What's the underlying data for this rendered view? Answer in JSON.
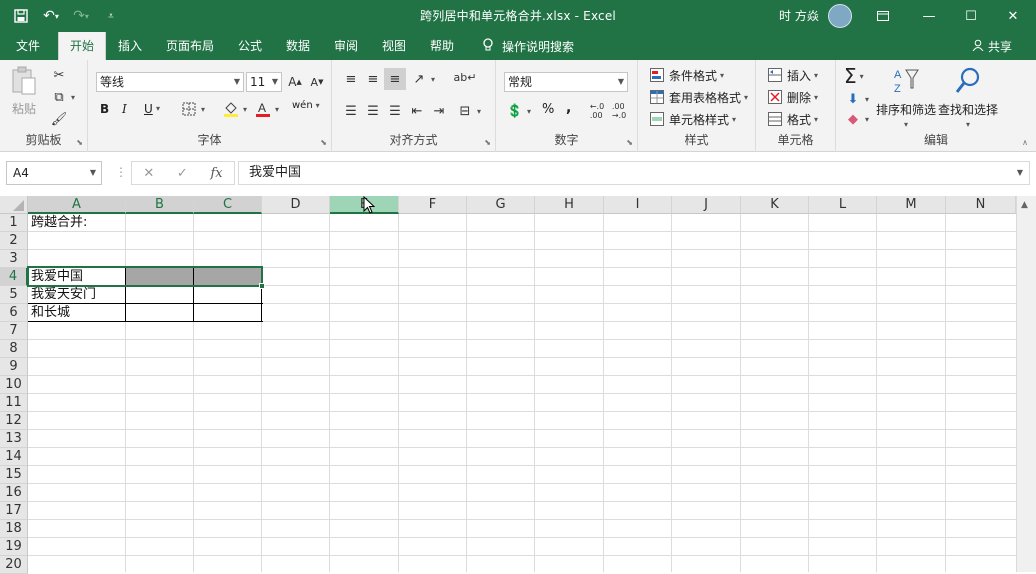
{
  "titlebar": {
    "title": "跨列居中和单元格合并.xlsx  -  Excel",
    "user": "时 方焱",
    "icons": [
      "save-icon",
      "undo-icon",
      "redo-icon",
      "customize-qat-icon"
    ],
    "window_controls": [
      "ribbon-display-options-icon",
      "minimize-icon",
      "maximize-icon",
      "close-icon"
    ]
  },
  "tabs": {
    "items": [
      {
        "label": "文件"
      },
      {
        "label": "开始"
      },
      {
        "label": "插入"
      },
      {
        "label": "页面布局"
      },
      {
        "label": "公式"
      },
      {
        "label": "数据"
      },
      {
        "label": "审阅"
      },
      {
        "label": "视图"
      },
      {
        "label": "帮助"
      }
    ],
    "active": "开始",
    "tell_me": "操作说明搜索",
    "share": "共享"
  },
  "ribbon": {
    "clipboard": {
      "label": "剪贴板",
      "paste": "粘贴"
    },
    "font": {
      "label": "字体",
      "font_name": "等线",
      "font_size": "11",
      "bold": "B",
      "italic": "I",
      "underline": "U",
      "wen": "wén"
    },
    "alignment": {
      "label": "对齐方式"
    },
    "number": {
      "label": "数字",
      "format": "常规",
      "percent": "%",
      "comma": ","
    },
    "styles": {
      "label": "样式",
      "conditional": "条件格式",
      "table": "套用表格格式",
      "cell_styles": "单元格样式"
    },
    "cells": {
      "label": "单元格",
      "insert": "插入",
      "delete": "删除",
      "format": "格式"
    },
    "editing": {
      "label": "编辑",
      "sort": "排序和筛选",
      "find": "查找和选择"
    }
  },
  "formula_bar": {
    "name_box": "A4",
    "fx": "fx",
    "content": "我爱中国"
  },
  "sheet": {
    "columns": [
      "A",
      "B",
      "C",
      "D",
      "E",
      "F",
      "G",
      "H",
      "I",
      "J",
      "K",
      "L",
      "M",
      "N"
    ],
    "rows": [
      "1",
      "2",
      "3",
      "4",
      "5",
      "6",
      "7",
      "8",
      "9",
      "10",
      "11",
      "12",
      "13",
      "14",
      "15",
      "16",
      "17",
      "18",
      "19",
      "20"
    ],
    "selected_cell": "A4",
    "cells": {
      "A1": "跨越合并:",
      "A4": "我爱中国",
      "A5": "我爱天安门",
      "A6": "和长城"
    }
  },
  "colors": {
    "accent": "#217346",
    "selection_shade": "#a6a6a6",
    "highlight_header": "#9fd5b7"
  }
}
